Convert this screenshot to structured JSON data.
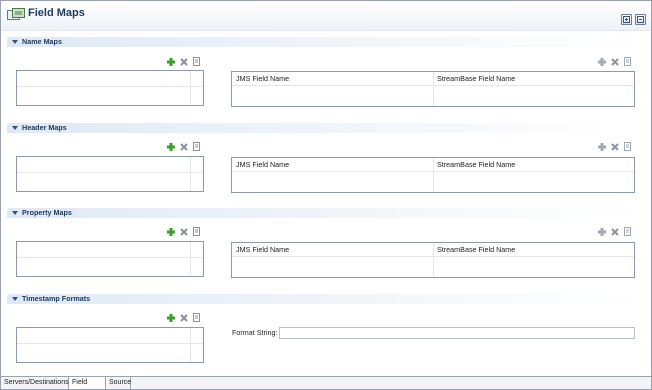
{
  "editor": {
    "title": "Field Maps"
  },
  "toolbar": {
    "add_icon": "plus-icon",
    "remove_icon": "x-icon",
    "copy_icon": "copy-icon"
  },
  "sections": [
    {
      "title": "Name Maps",
      "columns": [
        "JMS Field Name",
        "StreamBase Field Name"
      ]
    },
    {
      "title": "Header Maps",
      "columns": [
        "JMS Field Name",
        "StreamBase Field Name"
      ]
    },
    {
      "title": "Property Maps",
      "columns": [
        "JMS Field Name",
        "StreamBase Field Name"
      ]
    },
    {
      "title": "Timestamp Formats",
      "format_label": "Format String:",
      "format_value": ""
    }
  ],
  "tabs": [
    "Servers/Destinations",
    "Field Maps",
    "Source"
  ],
  "active_tab": "Field Maps",
  "colors": {
    "title": "#1f3a60",
    "section_bar": "#dfe8f4",
    "add_green": "#3e9b2f",
    "disabled_gray": "#a3a9b2"
  }
}
